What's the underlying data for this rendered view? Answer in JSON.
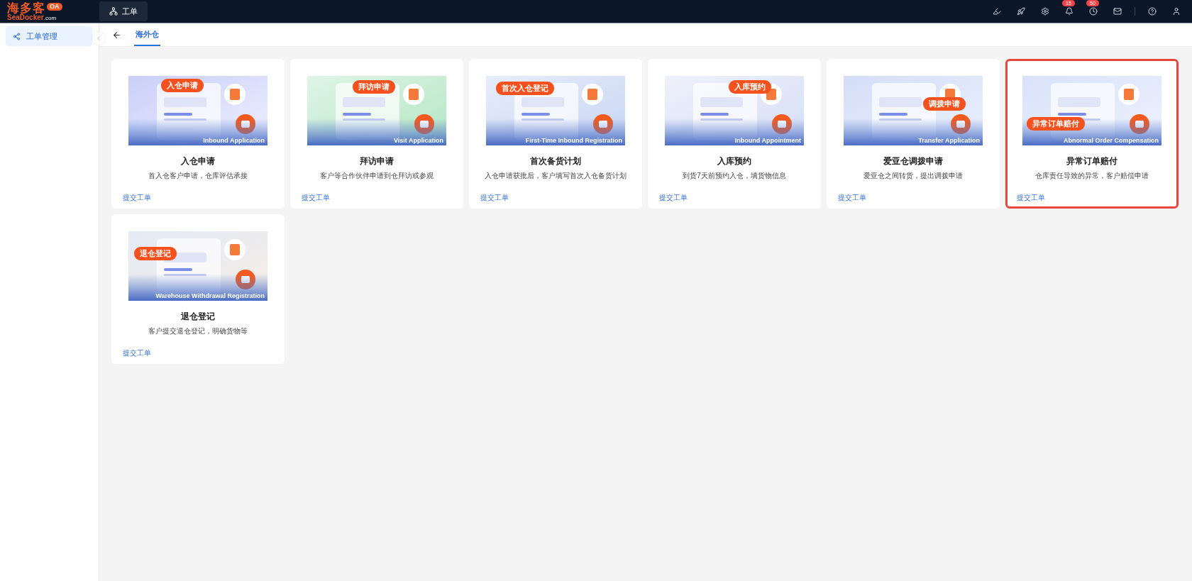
{
  "header": {
    "logo": {
      "name": "海多客",
      "sub": "SeaDocker",
      "domain": ".com",
      "tag": "OA"
    },
    "tabs": [
      {
        "label": "工单",
        "selected": true
      }
    ],
    "badges": [
      {
        "kind": "highlighter"
      },
      {
        "kind": "rocket"
      },
      {
        "kind": "settings"
      },
      {
        "kind": "bell",
        "count": "15"
      },
      {
        "kind": "clock",
        "count": "50"
      },
      {
        "kind": "mail"
      },
      {
        "kind": "divider"
      },
      {
        "kind": "help"
      },
      {
        "kind": "user"
      }
    ]
  },
  "sidebar": {
    "items": [
      {
        "label": "工单管理",
        "selected": true
      }
    ]
  },
  "breadcrumb": {
    "tabs": [
      {
        "label": "海外仓",
        "selected": true
      }
    ]
  },
  "cards": [
    {
      "badge": "入仓申请",
      "caption": "Inbound Application",
      "title": "入仓申请",
      "description": "首入仓客户申请，仓库评估承接",
      "link": "提交工单",
      "highlighted": false
    },
    {
      "badge": "拜访申请",
      "caption": "Visit Application",
      "title": "拜访申请",
      "description": "客户等合作伙伴申请到仓拜访或参观",
      "link": "提交工单",
      "highlighted": false
    },
    {
      "badge": "首次入仓登记",
      "caption": "First-Time Inbound Registration",
      "title": "首次备货计划",
      "description": "入仓申请获批后，客户填写首次入仓备货计划",
      "link": "提交工单",
      "highlighted": false
    },
    {
      "badge": "入库预约",
      "caption": "Inbound Appointment",
      "title": "入库预约",
      "description": "到货7天前预约入仓，填货物信息",
      "link": "提交工单",
      "highlighted": false
    },
    {
      "badge": "调拨申请",
      "caption": "Transfer Application",
      "title": "爱亚仓调拨申请",
      "description": "爱亚仓之间转货，提出调拨申请",
      "link": "提交工单",
      "highlighted": false
    },
    {
      "badge": "异常订单赔付",
      "caption": "Abnormal Order Compensation",
      "title": "异常订单赔付",
      "description": "仓库责任导致的异常，客户赔偿申请",
      "link": "提交工单",
      "highlighted": true
    },
    {
      "badge": "退仓登记",
      "caption": "Warehouse Withdrawal Registration",
      "title": "退仓登记",
      "description": "客户提交退仓登记，明确货物等",
      "link": "提交工单",
      "highlighted": false
    }
  ]
}
